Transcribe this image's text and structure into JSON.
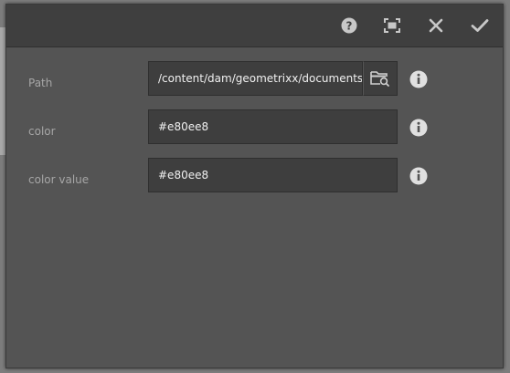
{
  "toolbar": {
    "icons": [
      "help-icon",
      "fullscreen-icon",
      "close-icon",
      "check-icon"
    ]
  },
  "fields": [
    {
      "label": "Path",
      "value": "/content/dam/geometrixx/documents",
      "icon": "info-icon",
      "browse_icon": "folder-search-icon"
    },
    {
      "label": "color",
      "value": "#e80ee8",
      "icon": "info-icon"
    },
    {
      "label": "color value",
      "value": "#e80ee8",
      "icon": "info-icon"
    }
  ],
  "colors": {
    "dialog_bg": "#545454",
    "toolbar_bg": "#3f3f3f",
    "input_bg": "#3e3e3e",
    "label_text": "#a6a6a6",
    "input_text": "#f0f0f0",
    "icon": "#d0d0d0"
  }
}
